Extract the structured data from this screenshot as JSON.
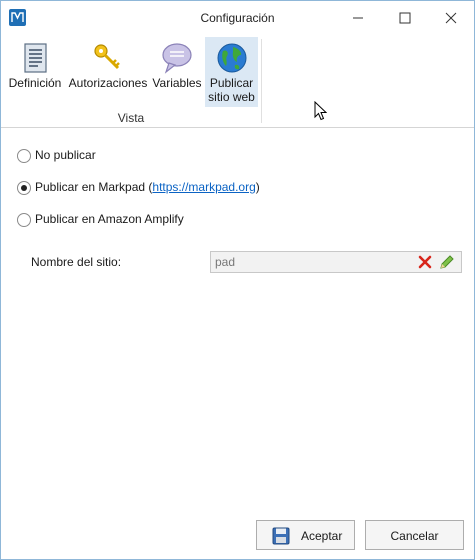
{
  "window": {
    "title": "Configuración",
    "minimize": "minimize",
    "maximize": "maximize",
    "close": "close"
  },
  "ribbon": {
    "buttons": [
      {
        "label": "Definición",
        "icon": "document-icon"
      },
      {
        "label": "Autorizaciones",
        "icon": "keys-icon"
      },
      {
        "label": "Variables",
        "icon": "speech-bubble-icon"
      },
      {
        "label": "Publicar sitio web",
        "icon": "globe-icon",
        "selected": true
      }
    ],
    "group_label": "Vista"
  },
  "publish_options": {
    "no_publish": "No publicar",
    "markpad_prefix": "Publicar en Markpad (",
    "markpad_link": "https://markpad.org",
    "markpad_suffix": ")",
    "amplify": "Publicar en Amazon Amplify",
    "selected": "markpad"
  },
  "site_name": {
    "label": "Nombre del sitio:",
    "value": "pad"
  },
  "footer": {
    "accept": "Aceptar",
    "cancel": "Cancelar"
  },
  "colors": {
    "accent": "#1f6fb5",
    "link": "#0b63c4",
    "selected_ribbon": "#dbe8f4"
  }
}
